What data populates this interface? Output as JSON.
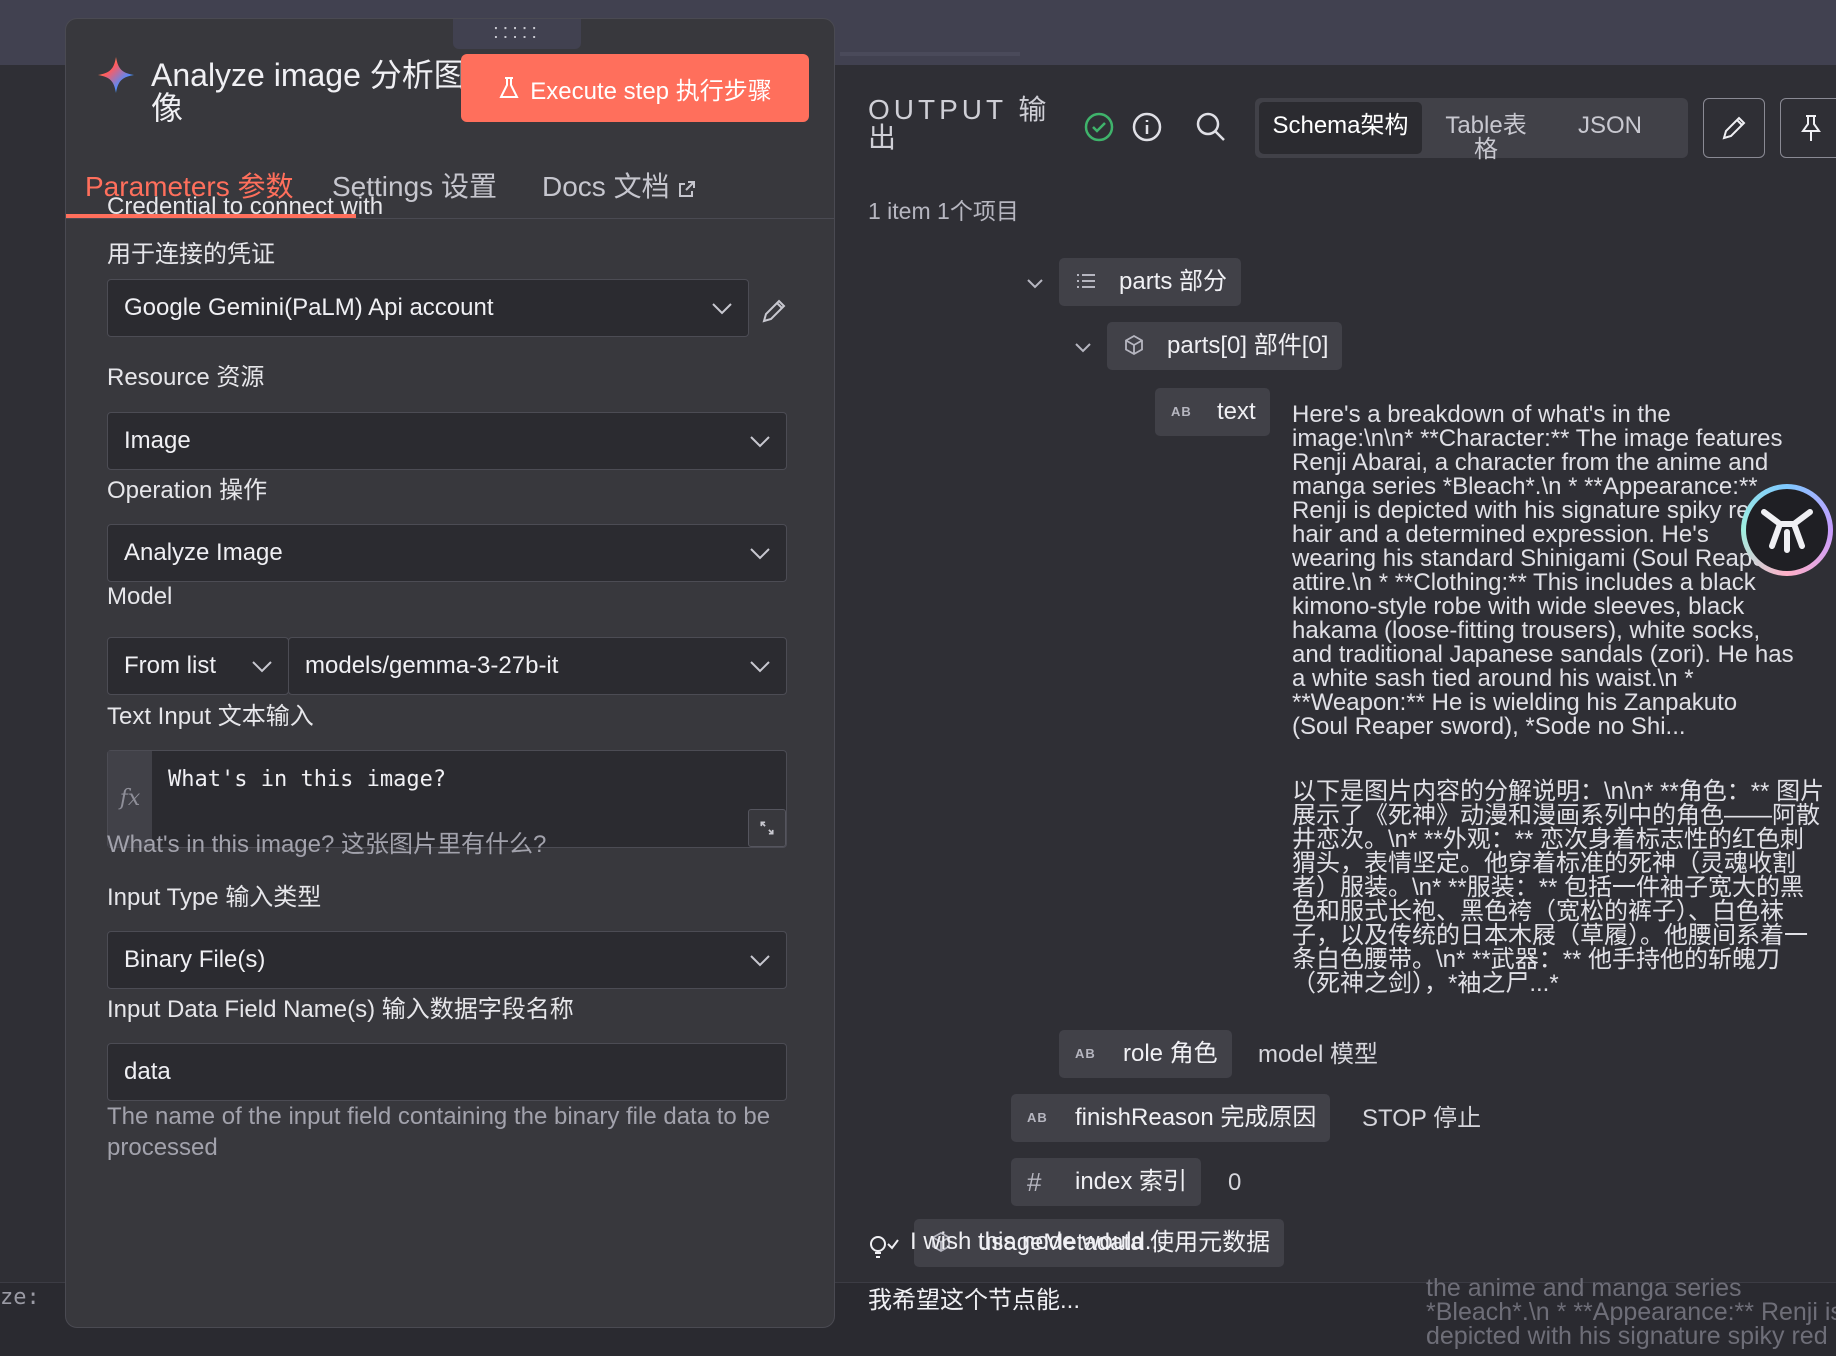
{
  "background": {
    "left_fragment": "ze:  ",
    "right_fragment": "the anime and manga series\n*Bleach*.\\n * **Appearance:** Renji is\ndepicted with his signature spiky red"
  },
  "panel": {
    "drag_handle": ":::::",
    "title": "Analyze image 分析图像",
    "execute_label": "Execute step 执行步骤",
    "tabs": [
      {
        "label": "Parameters 参数",
        "active": true
      },
      {
        "label": "Settings 设置",
        "active": false
      },
      {
        "label": "Docs 文档",
        "active": false
      }
    ],
    "credential": {
      "label_en": "Credential to connect with",
      "label_cn": "用于连接的凭证",
      "value": "Google Gemini(PaLM) Api account"
    },
    "resource": {
      "label": "Resource 资源",
      "value": "Image"
    },
    "operation": {
      "label": "Operation 操作",
      "value": "Analyze Image"
    },
    "model": {
      "label": "Model",
      "mode": "From list",
      "value": "models/gemma-3-27b-it"
    },
    "text_input": {
      "label": "Text Input 文本输入",
      "fx": "fx",
      "value": "What's in this image?",
      "hint": "What's in this image? 这张图片里有什么?"
    },
    "input_type": {
      "label": "Input Type 输入类型",
      "value": "Binary File(s)"
    },
    "input_field": {
      "label": "Input Data Field Name(s) 输入数据字段名称",
      "value": "data",
      "hint": "The name of the input field containing the binary file data to be processed"
    }
  },
  "output": {
    "title": "OUTPUT 输出",
    "views": [
      "Schema架构",
      "Table表格",
      "JSON"
    ],
    "active_view": "Schema架构",
    "count": "1 item 1个项目",
    "tree": {
      "parts": "parts 部分",
      "parts0": "parts[0] 部件[0]",
      "text_key": "text",
      "text_value_en": "Here's a breakdown of what's in the image:\\n\\n* **Character:** The image features Renji Abarai, a character from the anime and manga series *Bleach*.\\n * **Appearance:** Renji is depicted with his signature spiky red hair and a determined expression. He's wearing his standard Shinigami (Soul Reaper) attire.\\n * **Clothing:** This includes a black kimono-style robe with wide sleeves, black hakama (loose-fitting trousers), white socks, and traditional Japanese sandals (zori). He has a white sash tied around his waist.\\n * **Weapon:** He is wielding his Zanpakuto (Soul Reaper sword), *Sode no Shi...",
      "text_value_cn": "以下是图片内容的分解说明：\\n\\n* **角色：** 图片展示了《死神》动漫和漫画系列中的角色——阿散井恋次。\\n* **外观：** 恋次身着标志性的红色刺猬头，表情坚定。他穿着标准的死神（灵魂收割者）服装。\\n* **服装：** 包括一件袖子宽大的黑色和服式长袍、黑色袴（宽松的裤子）、白色袜子，以及传统的日本木屐（草履）。他腰间系着一条白色腰带。\\n* **武器：** 他手持他的斩魄刀（死神之剑），*袖之尸...*",
      "role_key": "role 角色",
      "role_value": "model 模型",
      "finish_key": "finishReason 完成原因",
      "finish_value": "STOP 停止",
      "index_key": "index 索引",
      "index_value": "0",
      "usage_key": "usageMetadata 使用元数据"
    },
    "feedback": "I wish this node would...",
    "feedback_cn": "我希望这个节点能..."
  },
  "colors": {
    "accent": "#ff6f5c",
    "panel": "#38383d",
    "success": "#3fb36b"
  }
}
